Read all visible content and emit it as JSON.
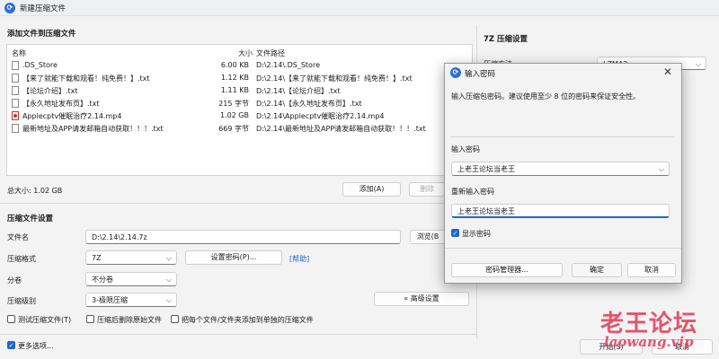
{
  "window": {
    "title": "新建压缩文件"
  },
  "files_section": {
    "title": "添加文件到压缩文件",
    "columns": {
      "name": "名称",
      "size": "大小",
      "path": "文件路径"
    },
    "files": [
      {
        "name": ".DS_Store",
        "size": "6.00 KB",
        "path": "D:\\2.14\\.DS_Store",
        "icon": "file-icon"
      },
      {
        "name": "【来了就能下载和观看！纯免费！】.txt",
        "size": "1.12 KB",
        "path": "D:\\2.14\\【来了就能下载和观看！纯免费！】.txt",
        "icon": "text-file-icon"
      },
      {
        "name": "【论坛介绍】.txt",
        "size": "1.11 KB",
        "path": "D:\\2.14\\【论坛介绍】.txt",
        "icon": "text-file-icon"
      },
      {
        "name": "【永久地址发布页】.txt",
        "size": "215 字节",
        "path": "D:\\2.14\\【永久地址发布页】.txt",
        "icon": "text-file-icon"
      },
      {
        "name": "Applecptv催眠治疗2.14.mp4",
        "size": "1.02 GB",
        "path": "D:\\2.14\\Applecptv催眠治疗2.14.mp4",
        "icon": "video-file-icon"
      },
      {
        "name": "最新地址及APP请发邮箱自动获取！！！.txt",
        "size": "669 字节",
        "path": "D:\\2.14\\最新地址及APP请发邮箱自动获取！！！.txt",
        "icon": "text-file-icon"
      }
    ],
    "total_size": "总大小: 1.02 GB",
    "add_button": "添加(A)",
    "delete_button": "删除"
  },
  "settings": {
    "title": "压缩文件设置",
    "filename_label": "文件名",
    "filename_value": "D:\\2.14\\2.14.7z",
    "browse_button": "浏览(B",
    "format_label": "压缩格式",
    "format_value": "7Z",
    "set_password_button": "设置密码(P)...",
    "help_link": "[帮助]",
    "split_label": "分卷",
    "split_value": "不分卷",
    "level_label": "压缩级别",
    "level_value": "3-极限压缩",
    "advanced_button": "« 高级设置",
    "options": [
      {
        "label": "测试压缩文件(T)",
        "checked": false
      },
      {
        "label": "压缩后删除原始文件",
        "checked": false
      },
      {
        "label": "把每个文件/文件夹添加到单独的压缩文件",
        "checked": false
      }
    ],
    "more_options": {
      "label": "更多选项...",
      "checked": true
    }
  },
  "footer": {
    "start_button": "开始(S)",
    "cancel_button": "取消"
  },
  "seven_z": {
    "title": "7Z 压缩设置",
    "method_label": "压缩方法",
    "method_value": "LZMA2"
  },
  "password_dialog": {
    "title": "输入密码",
    "description": "输入压缩包密码。建议使用至少 8 位的密码来保证安全性。",
    "password_label": "输入密码",
    "password_value": "上老王论坛当老王",
    "confirm_label": "重新输入密码",
    "confirm_value": "上老王论坛当老王",
    "show_password_label": "显示密码",
    "show_password_checked": true,
    "manager_button": "密码管理器...",
    "ok_button": "确定",
    "cancel_button": "取消"
  },
  "watermark": {
    "cn": "老王论坛",
    "en": "laowang.vip"
  },
  "colors": {
    "accent": "#1f66cf",
    "watermark": "#e0455f",
    "window_bg": "#f3f3f3"
  }
}
